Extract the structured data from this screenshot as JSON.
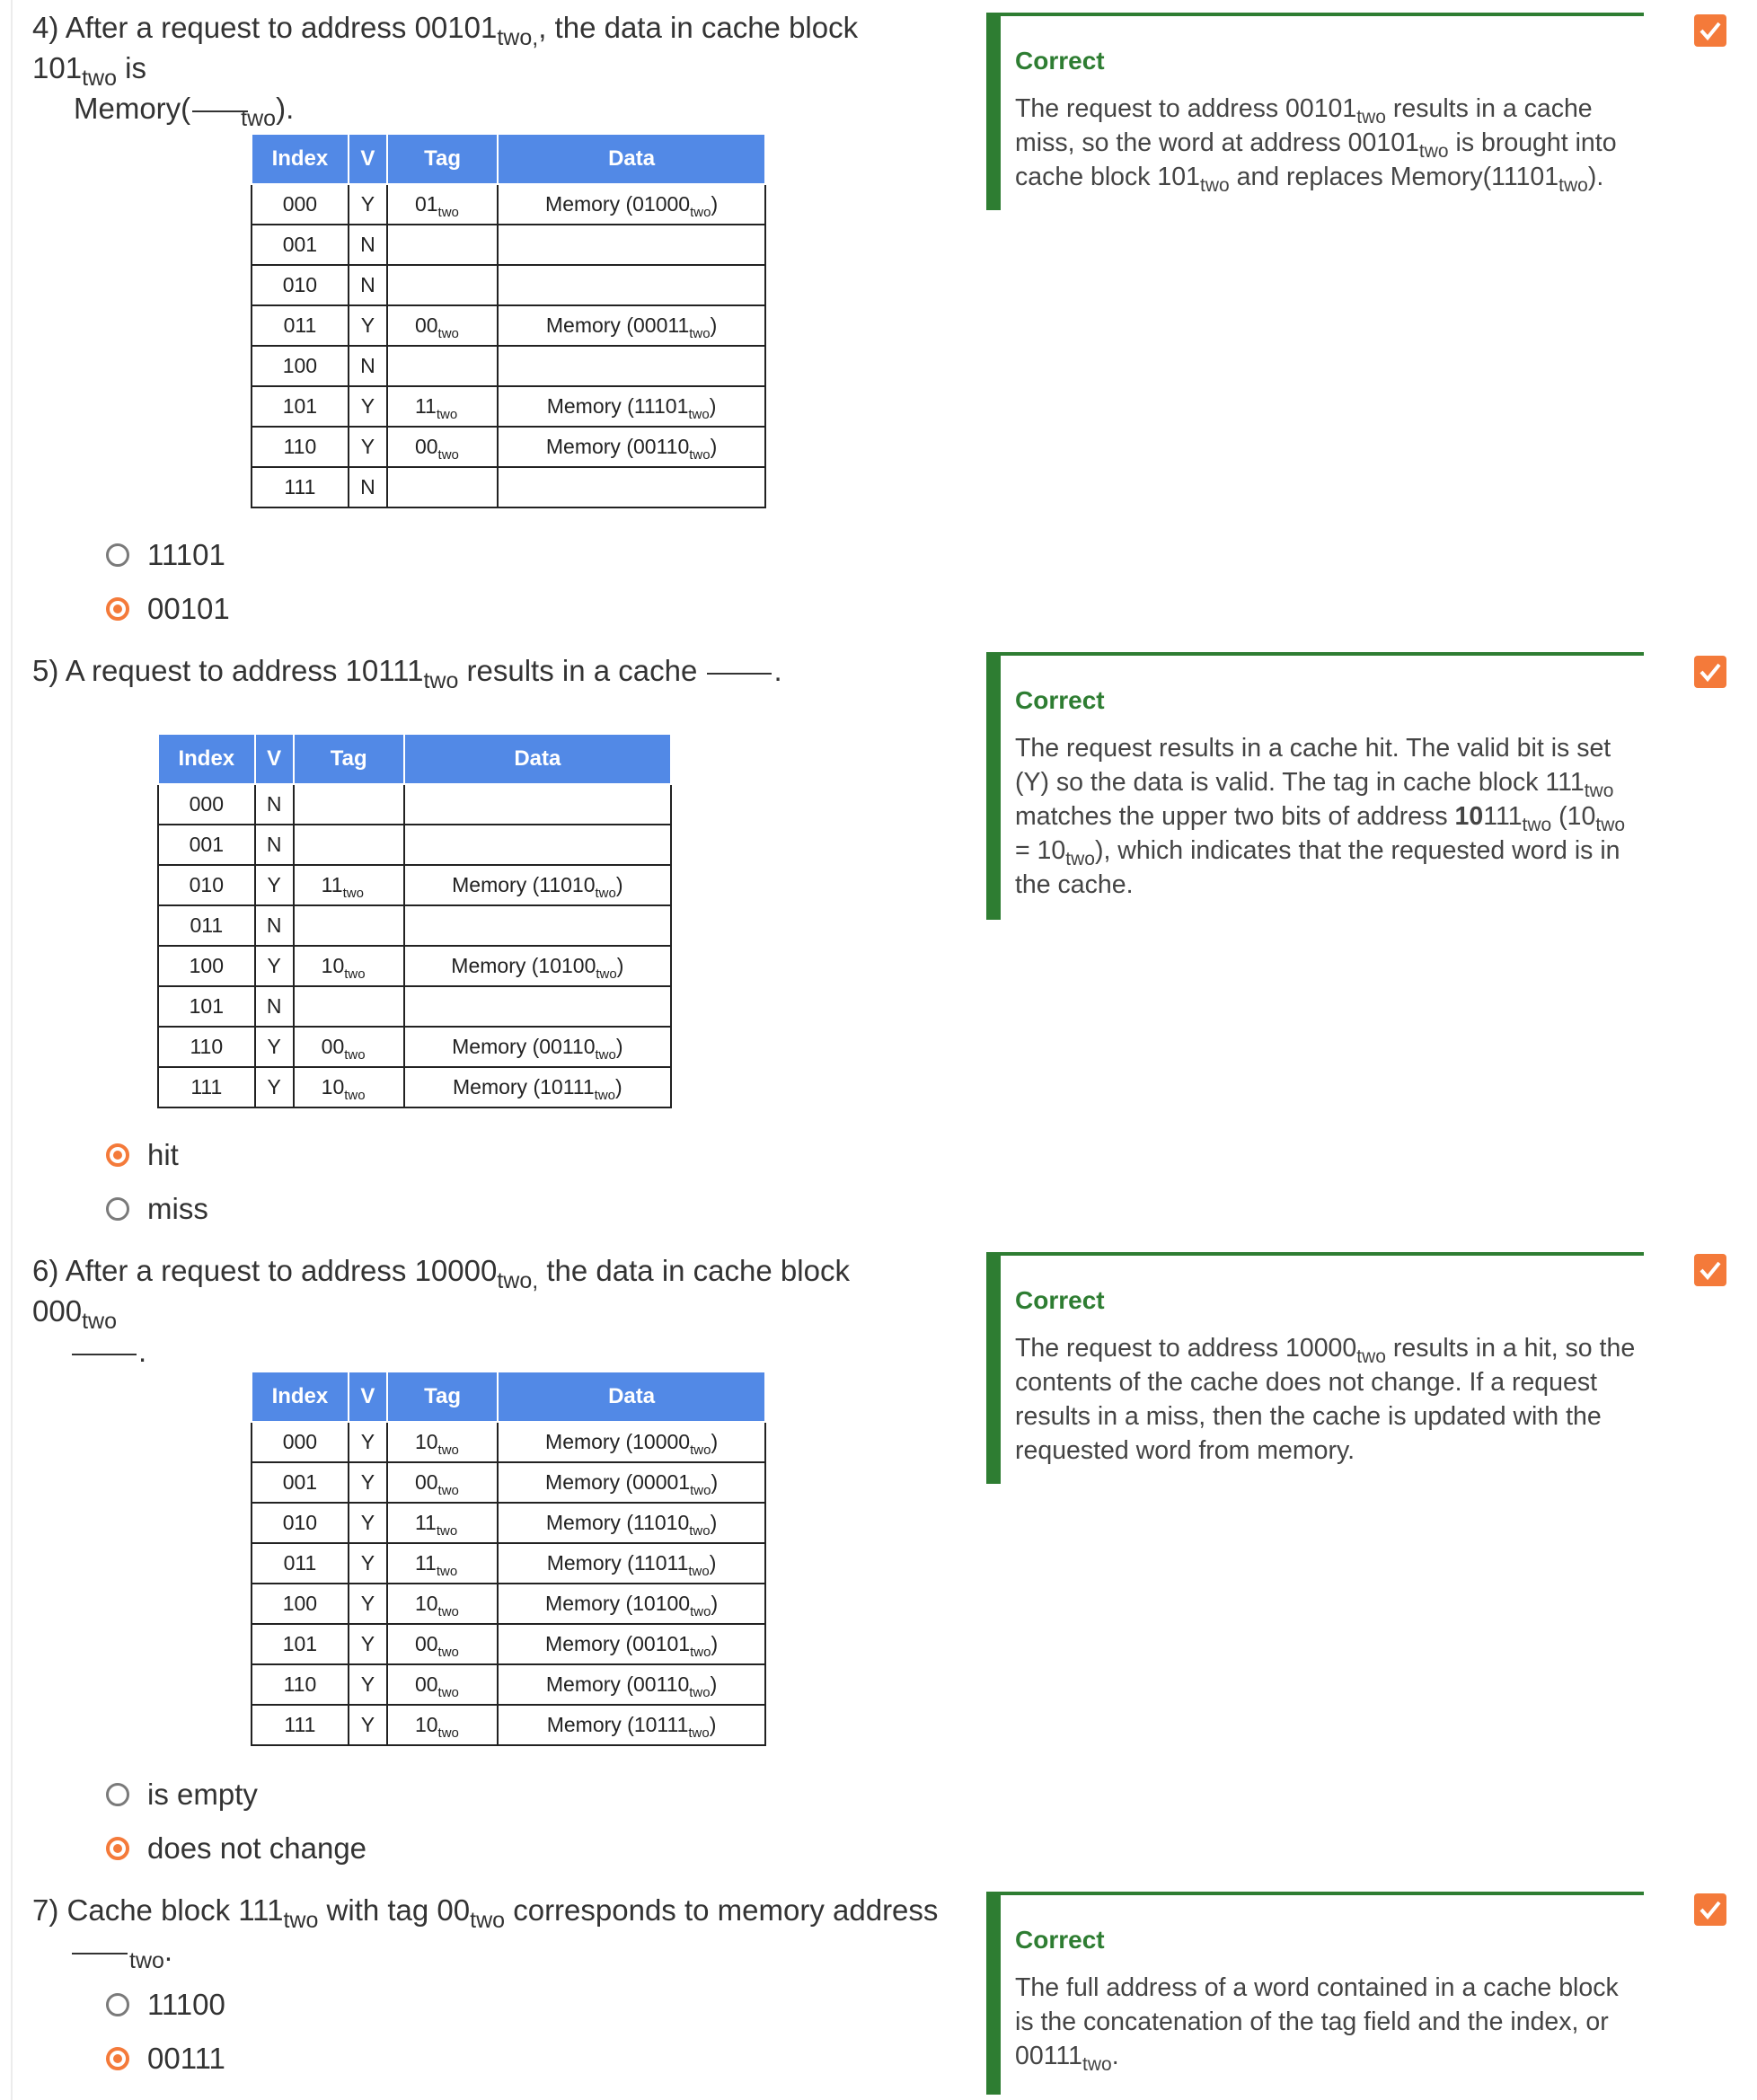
{
  "questions": [
    {
      "num": "4)",
      "text_a": "After a request to address 00101",
      "text_b": ", the data in cache block 101",
      "text_c": " is",
      "text_d": "Memory(",
      "text_e": ").",
      "sub": "two",
      "sub_comma": "two,",
      "table": {
        "headers": [
          "Index",
          "V",
          "Tag",
          "Data"
        ],
        "rows": [
          {
            "index": "000",
            "v": "Y",
            "tag": "01",
            "data": "Memory (01000",
            "close": ")"
          },
          {
            "index": "001",
            "v": "N",
            "tag": "",
            "data": "",
            "close": ""
          },
          {
            "index": "010",
            "v": "N",
            "tag": "",
            "data": "",
            "close": ""
          },
          {
            "index": "011",
            "v": "Y",
            "tag": "00",
            "data": "Memory (00011",
            "close": ")"
          },
          {
            "index": "100",
            "v": "N",
            "tag": "",
            "data": "",
            "close": ""
          },
          {
            "index": "101",
            "v": "Y",
            "tag": "11",
            "data": "Memory (11101",
            "close": ")"
          },
          {
            "index": "110",
            "v": "Y",
            "tag": "00",
            "data": "Memory (00110",
            "close": ")"
          },
          {
            "index": "111",
            "v": "N",
            "tag": "",
            "data": "",
            "close": ""
          }
        ]
      },
      "options": [
        {
          "label": "11101",
          "selected": false
        },
        {
          "label": "00101",
          "selected": true
        }
      ],
      "feedback": {
        "title": "Correct",
        "t1": "The request to address 00101",
        "t2": " results in a cache miss, so the word at address 00101",
        "t3": " is brought into cache block 101",
        "t4": " and replaces Memory(11101",
        "t5": ")."
      }
    },
    {
      "num": "5)",
      "text_a": "A request to address 10111",
      "text_b": " results in a cache",
      "text_c": ".",
      "sub": "two",
      "table": {
        "headers": [
          "Index",
          "V",
          "Tag",
          "Data"
        ],
        "rows": [
          {
            "index": "000",
            "v": "N",
            "tag": "",
            "data": "",
            "close": ""
          },
          {
            "index": "001",
            "v": "N",
            "tag": "",
            "data": "",
            "close": ""
          },
          {
            "index": "010",
            "v": "Y",
            "tag": "11",
            "data": "Memory (11010",
            "close": ")"
          },
          {
            "index": "011",
            "v": "N",
            "tag": "",
            "data": "",
            "close": ""
          },
          {
            "index": "100",
            "v": "Y",
            "tag": "10",
            "data": "Memory (10100",
            "close": ")"
          },
          {
            "index": "101",
            "v": "N",
            "tag": "",
            "data": "",
            "close": ""
          },
          {
            "index": "110",
            "v": "Y",
            "tag": "00",
            "data": "Memory (00110",
            "close": ")"
          },
          {
            "index": "111",
            "v": "Y",
            "tag": "10",
            "data": "Memory (10111",
            "close": ")"
          }
        ]
      },
      "options": [
        {
          "label": "hit",
          "selected": true
        },
        {
          "label": "miss",
          "selected": false
        }
      ],
      "feedback": {
        "title": "Correct",
        "t1": "The request results in a cache hit. The valid bit is set (Y) so the data is valid. The tag in cache block 111",
        "t2": " matches the upper two bits of address ",
        "bold": "10",
        "t3": "111",
        "t4": " (10",
        "t5": " = 10",
        "t6": "), which indicates that the requested word is in the cache."
      }
    },
    {
      "num": "6)",
      "text_a": "After a request to address 10000",
      "text_b": " the data in cache block 000",
      "text_c": ".",
      "sub": "two",
      "sub_comma": "two,",
      "table": {
        "headers": [
          "Index",
          "V",
          "Tag",
          "Data"
        ],
        "rows": [
          {
            "index": "000",
            "v": "Y",
            "tag": "10",
            "data": "Memory (10000",
            "close": ")"
          },
          {
            "index": "001",
            "v": "Y",
            "tag": "00",
            "data": "Memory (00001",
            "close": ")"
          },
          {
            "index": "010",
            "v": "Y",
            "tag": "11",
            "data": "Memory (11010",
            "close": ")"
          },
          {
            "index": "011",
            "v": "Y",
            "tag": "11",
            "data": "Memory (11011",
            "close": ")"
          },
          {
            "index": "100",
            "v": "Y",
            "tag": "10",
            "data": "Memory (10100",
            "close": ")"
          },
          {
            "index": "101",
            "v": "Y",
            "tag": "00",
            "data": "Memory (00101",
            "close": ")"
          },
          {
            "index": "110",
            "v": "Y",
            "tag": "00",
            "data": "Memory (00110",
            "close": ")"
          },
          {
            "index": "111",
            "v": "Y",
            "tag": "10",
            "data": "Memory (10111",
            "close": ")"
          }
        ]
      },
      "options": [
        {
          "label": "is empty",
          "selected": false
        },
        {
          "label": "does not change",
          "selected": true
        }
      ],
      "feedback": {
        "title": "Correct",
        "t1": "The request to address 10000",
        "t2": " results in a hit, so the contents of the cache does not change. If a request results in a miss, then the cache is updated with the requested word from memory."
      }
    },
    {
      "num": "7)",
      "text_a": "Cache block 111",
      "text_b": " with tag 00",
      "text_c": " corresponds to memory address",
      "text_d": "two",
      "text_e": ".",
      "sub": "two",
      "options": [
        {
          "label": "11100",
          "selected": false
        },
        {
          "label": "00111",
          "selected": true
        }
      ],
      "feedback": {
        "title": "Correct",
        "t1": "The full address of a word contained in a cache block is the concatenation of the tag field and the index, or 00111",
        "t2": "two",
        "t3": "."
      }
    }
  ],
  "colors": {
    "accent": "#f47a3a",
    "correct": "#2e7d32",
    "header": "#5289e6"
  }
}
